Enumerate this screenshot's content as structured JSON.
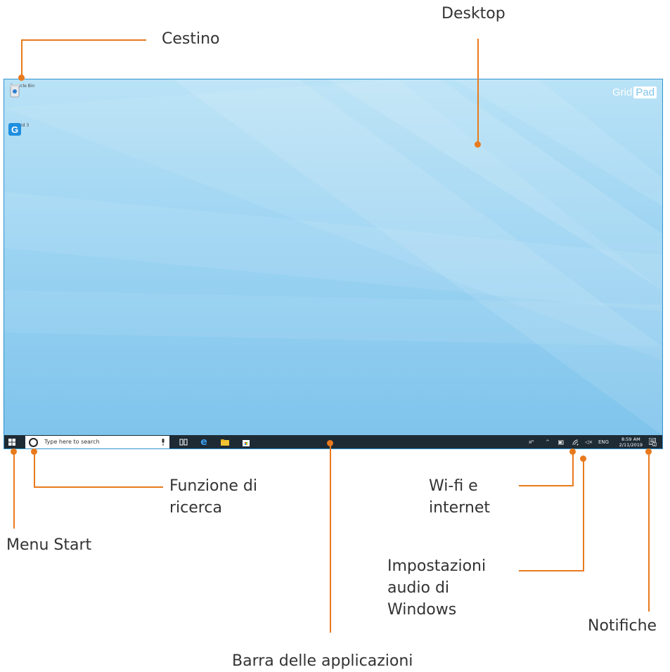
{
  "callouts": {
    "cestino": "Cestino",
    "desktop": "Desktop",
    "search": "Funzione di\nricerca",
    "start": "Menu Start",
    "wifi": "Wi-fi e\ninternet",
    "audio": "Impostazioni\naudio di\nWindows",
    "notifications": "Notifiche",
    "taskbar": "Barra delle applicazioni"
  },
  "desktop": {
    "icons": [
      {
        "label": "Recycle Bin",
        "icon": "recycle-bin-icon"
      },
      {
        "label": "Grid 3",
        "icon": "grid3-icon",
        "glyph": "G"
      }
    ],
    "brand": {
      "part1": "Grid",
      "part2": "Pad"
    }
  },
  "taskbar": {
    "search_placeholder": "Type here to search",
    "apps": [
      "task-view-icon",
      "edge-icon",
      "file-explorer-icon",
      "store-icon"
    ],
    "edge_glyph": "e",
    "tray": {
      "people": "ᴙᴿ",
      "chevron": "^",
      "volume": "◁×",
      "lang": "ENG"
    },
    "clock": {
      "time": "8:59 AM",
      "date": "2/11/2019"
    },
    "notification_count": "2"
  },
  "colors": {
    "accent": "#e87a1d",
    "taskbar": "#1e2b35",
    "desktop": "#9dd4f2"
  }
}
